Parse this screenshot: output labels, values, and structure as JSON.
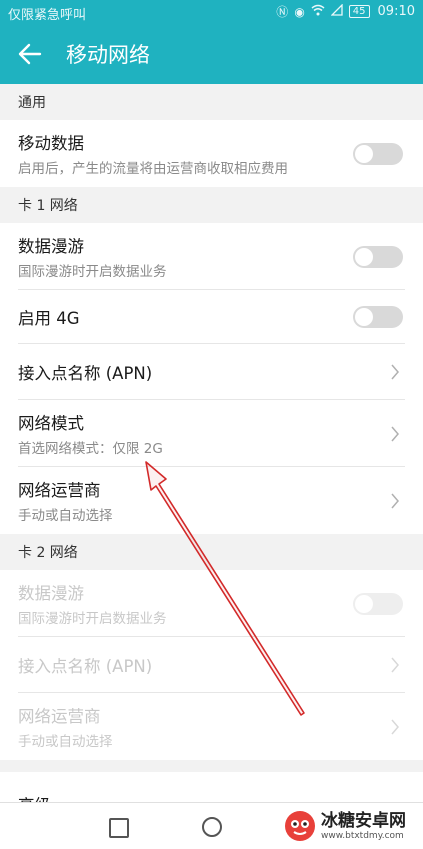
{
  "status_bar": {
    "carrier_text": "仅限紧急呼叫",
    "battery": "45",
    "time": "09:10"
  },
  "app_bar": {
    "title": "移动网络"
  },
  "sections": [
    {
      "header": "通用",
      "rows": [
        {
          "title": "移动数据",
          "subtitle": "启用后，产生的流量将由运营商收取相应费用",
          "control": "toggle",
          "state": "off",
          "enabled": true
        }
      ]
    },
    {
      "header": "卡 1 网络",
      "rows": [
        {
          "title": "数据漫游",
          "subtitle": "国际漫游时开启数据业务",
          "control": "toggle",
          "state": "off",
          "enabled": true
        },
        {
          "title": "启用 4G",
          "subtitle": "",
          "control": "toggle",
          "state": "off",
          "enabled": true
        },
        {
          "title": "接入点名称 (APN)",
          "subtitle": "",
          "control": "chevron",
          "enabled": true
        },
        {
          "title": "网络模式",
          "subtitle": "首选网络模式：仅限 2G",
          "control": "chevron",
          "enabled": true
        },
        {
          "title": "网络运营商",
          "subtitle": "手动或自动选择",
          "control": "chevron",
          "enabled": true
        }
      ]
    },
    {
      "header": "卡 2 网络",
      "rows": [
        {
          "title": "数据漫游",
          "subtitle": "国际漫游时开启数据业务",
          "control": "toggle",
          "state": "off",
          "enabled": false
        },
        {
          "title": "接入点名称 (APN)",
          "subtitle": "",
          "control": "chevron",
          "enabled": false
        },
        {
          "title": "网络运营商",
          "subtitle": "手动或自动选择",
          "control": "chevron",
          "enabled": false
        }
      ]
    }
  ],
  "partial_row": {
    "title": "高级"
  },
  "watermark": {
    "title": "冰糖安卓网",
    "url": "www.btxtdmy.com"
  },
  "colors": {
    "accent": "#1fb2c0",
    "annotation_arrow": "#d32a2a"
  }
}
